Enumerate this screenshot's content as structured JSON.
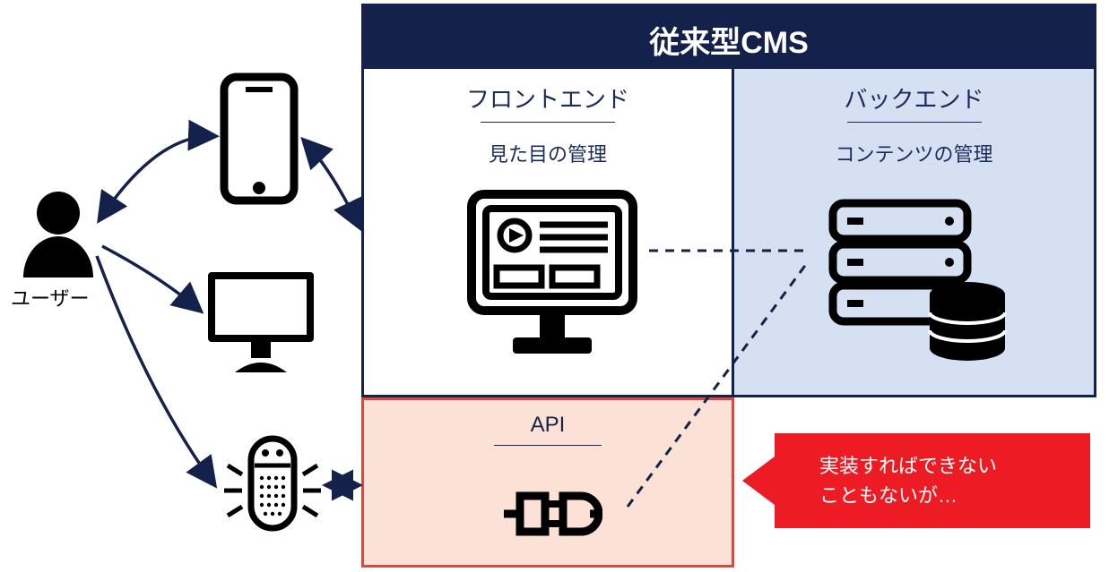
{
  "header": {
    "title": "従来型CMS"
  },
  "user": {
    "label": "ユーザー"
  },
  "frontend": {
    "title": "フロントエンド",
    "subtitle": "見た目の管理"
  },
  "backend": {
    "title": "バックエンド",
    "subtitle": "コンテンツの管理"
  },
  "api": {
    "title": "API"
  },
  "callout": {
    "line1": "実装すればできない",
    "line2": "こともないが…"
  }
}
